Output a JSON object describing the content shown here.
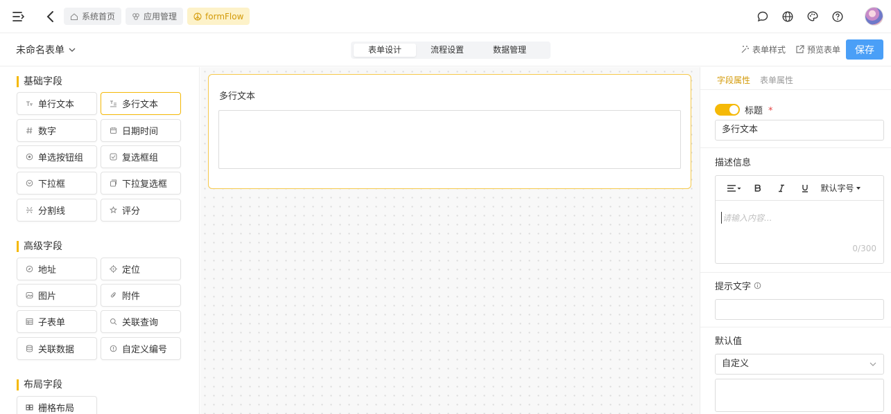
{
  "breadcrumb": {
    "tags": [
      {
        "label": "系统首页",
        "icon": "home-icon"
      },
      {
        "label": "应用管理",
        "icon": "apps-icon"
      },
      {
        "label": "formFlow",
        "icon": "peace-icon"
      }
    ]
  },
  "header": {
    "icons": [
      "chat-icon",
      "globe-icon",
      "palette-icon",
      "help-icon"
    ]
  },
  "subbar": {
    "form_name": "未命名表单",
    "tabs": [
      "表单设计",
      "流程设置",
      "数据管理"
    ],
    "active_tab": "表单设计",
    "style_label": "表单样式",
    "preview_label": "预览表单",
    "save_label": "保存"
  },
  "left_panel": {
    "basic_title": "基础字段",
    "basic_fields": [
      {
        "label": "单行文本",
        "icon": "text-icon"
      },
      {
        "label": "多行文本",
        "icon": "multiline-icon"
      },
      {
        "label": "数字",
        "icon": "hash-icon"
      },
      {
        "label": "日期时间",
        "icon": "calendar-icon"
      },
      {
        "label": "单选按钮组",
        "icon": "radio-icon"
      },
      {
        "label": "复选框组",
        "icon": "checkbox-icon"
      },
      {
        "label": "下拉框",
        "icon": "dropdown-icon"
      },
      {
        "label": "下拉复选框",
        "icon": "dropdown-multi-icon"
      },
      {
        "label": "分割线",
        "icon": "divider-icon"
      },
      {
        "label": "评分",
        "icon": "star-icon"
      }
    ],
    "advanced_title": "高级字段",
    "advanced_fields": [
      {
        "label": "地址",
        "icon": "compass-icon"
      },
      {
        "label": "定位",
        "icon": "locate-icon"
      },
      {
        "label": "图片",
        "icon": "image-icon"
      },
      {
        "label": "附件",
        "icon": "paperclip-icon"
      },
      {
        "label": "子表单",
        "icon": "table-icon"
      },
      {
        "label": "关联查询",
        "icon": "search-icon"
      },
      {
        "label": "关联数据",
        "icon": "database-icon"
      },
      {
        "label": "自定义编号",
        "icon": "info-icon"
      }
    ],
    "layout_title": "布局字段",
    "layout_fields": [
      {
        "label": "栅格布局",
        "icon": "grid-icon"
      }
    ]
  },
  "canvas": {
    "card_label": "多行文本"
  },
  "right_panel": {
    "tabs": [
      "字段属性",
      "表单属性"
    ],
    "title_label": "标题",
    "title_required": "*",
    "title_value": "多行文本",
    "desc_label": "描述信息",
    "editor_font_size": "默认字号",
    "editor_placeholder": "请输入内容...",
    "editor_count": "0/300",
    "hint_label": "提示文字",
    "default_label": "默认值",
    "default_select": "自定义"
  },
  "colors": {
    "accent": "#f5b907",
    "primary_button": "#4a9ff7"
  }
}
